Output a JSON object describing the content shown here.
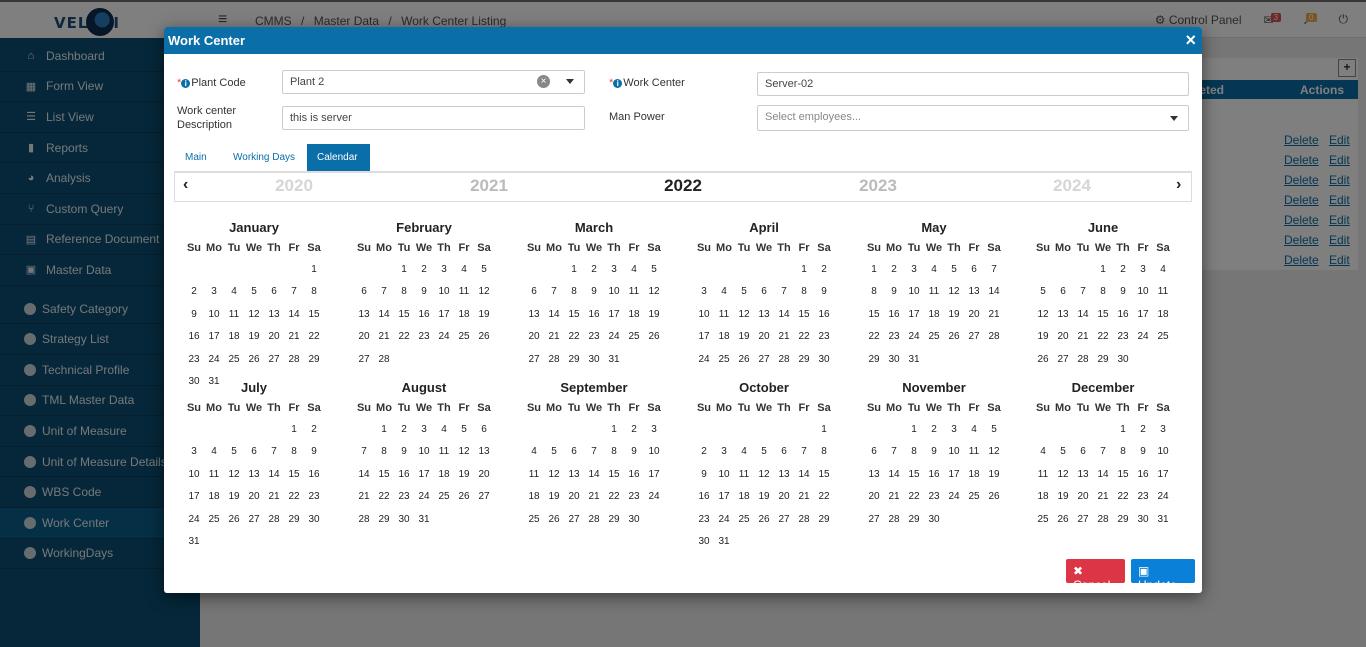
{
  "app": {
    "logo_text": "VELOSI",
    "breadcrumb": [
      "CMMS",
      "/",
      "Master Data",
      "/",
      "Work Center Listing"
    ],
    "control_panel": "Control Panel",
    "messages_badge": "3",
    "notifications_badge": "0"
  },
  "sidebar": {
    "main_items": [
      {
        "label": "Dashboard",
        "icon": "home-icon",
        "glyph": "⌂"
      },
      {
        "label": "Form View",
        "icon": "grid-icon",
        "glyph": "▦"
      },
      {
        "label": "List View",
        "icon": "list-icon",
        "glyph": "☰"
      },
      {
        "label": "Reports",
        "icon": "bar-chart-icon",
        "glyph": "▮"
      },
      {
        "label": "Analysis",
        "icon": "pie-chart-icon",
        "glyph": "◕"
      },
      {
        "label": "Custom Query",
        "icon": "query-icon",
        "glyph": "⑂"
      },
      {
        "label": "Reference Document",
        "icon": "document-icon",
        "glyph": "▤"
      },
      {
        "label": "Master Data",
        "icon": "table-icon",
        "glyph": "▣"
      }
    ],
    "sub_items": [
      {
        "label": "Safety Category"
      },
      {
        "label": "Strategy List"
      },
      {
        "label": "Technical Profile"
      },
      {
        "label": "TML Master Data"
      },
      {
        "label": "Unit of Measure"
      },
      {
        "label": "Unit of Measure Details"
      },
      {
        "label": "WBS Code"
      },
      {
        "label": "Work Center",
        "active": true
      },
      {
        "label": "WorkingDays"
      }
    ]
  },
  "background_table": {
    "header_col1": "leted",
    "header_col2": "Actions",
    "delete_label": "Delete",
    "edit_label": "Edit"
  },
  "modal": {
    "title": "Work Center",
    "close_glyph": "×",
    "plant_code_label": "Plant Code",
    "plant_code_value": "Plant 2",
    "work_center_label": "Work Center",
    "work_center_value": "Server-02",
    "description_label_line1": "Work center",
    "description_label_line2": "Description",
    "description_value": "this is server",
    "man_power_label": "Man Power",
    "man_power_placeholder": "Select employees...",
    "tabs": [
      "Main",
      "Working Days",
      "Calendar"
    ],
    "active_tab": "Calendar",
    "cancel_label": "Cancel",
    "update_label": "Update"
  },
  "calendar": {
    "prev_arrow": "‹",
    "next_arrow": "›",
    "years": [
      "2020",
      "2021",
      "2022",
      "2023",
      "2024"
    ],
    "current_year": "2022",
    "weekday_headers": [
      "Su",
      "Mo",
      "Tu",
      "We",
      "Th",
      "Fr",
      "Sa"
    ],
    "months": [
      {
        "name": "January",
        "start": 6,
        "days": 31
      },
      {
        "name": "February",
        "start": 2,
        "days": 28
      },
      {
        "name": "March",
        "start": 2,
        "days": 31
      },
      {
        "name": "April",
        "start": 5,
        "days": 30
      },
      {
        "name": "May",
        "start": 0,
        "days": 31
      },
      {
        "name": "June",
        "start": 3,
        "days": 30
      },
      {
        "name": "July",
        "start": 5,
        "days": 31
      },
      {
        "name": "August",
        "start": 1,
        "days": 31
      },
      {
        "name": "September",
        "start": 4,
        "days": 30
      },
      {
        "name": "October",
        "start": 6,
        "days": 31
      },
      {
        "name": "November",
        "start": 2,
        "days": 30
      },
      {
        "name": "December",
        "start": 4,
        "days": 31
      }
    ]
  }
}
